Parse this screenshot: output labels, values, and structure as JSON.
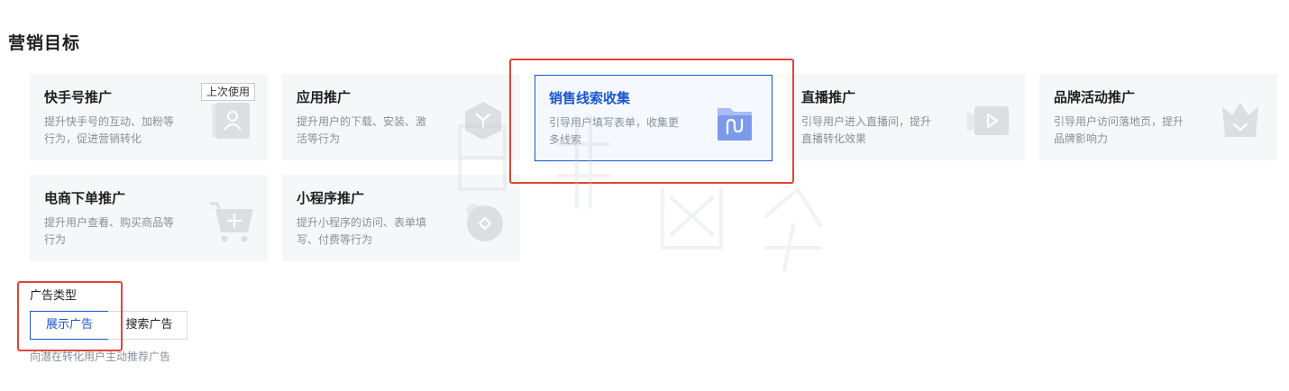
{
  "section": {
    "title": "营销目标"
  },
  "cards": [
    {
      "title": "快手号推广",
      "desc": "提升快手号的互动、加粉等行为，促进营销转化",
      "badge": "上次使用",
      "icon": "user-icon"
    },
    {
      "title": "应用推广",
      "desc": "提升用户的下载、安装、激活等行为",
      "icon": "app-hex-icon"
    },
    {
      "title": "销售线索收集",
      "desc": "引导用户填写表单，收集更多线索",
      "icon": "folder-icon",
      "selected": true
    },
    {
      "title": "直播推广",
      "desc": "引导用户进入直播间，提升直播转化效果",
      "icon": "video-camera-icon"
    },
    {
      "title": "品牌活动推广",
      "desc": "引导用户访问落地页，提升品牌影响力",
      "icon": "crown-icon"
    },
    {
      "title": "电商下单推广",
      "desc": "提升用户查看、购买商品等行为",
      "icon": "shopping-cart-icon"
    },
    {
      "title": "小程序推广",
      "desc": "提升小程序的访问、表单填写、付费等行为",
      "icon": "mini-program-icon"
    }
  ],
  "ad_type": {
    "label": "广告类型",
    "tabs": [
      {
        "label": "展示广告",
        "active": true
      },
      {
        "label": "搜索广告",
        "active": false
      }
    ],
    "hint": "向潜在转化用户主动推荐广告"
  },
  "colors": {
    "accent": "#1a55d1",
    "highlight_box": "#e0463a",
    "card_bg": "#f6f7f9"
  }
}
